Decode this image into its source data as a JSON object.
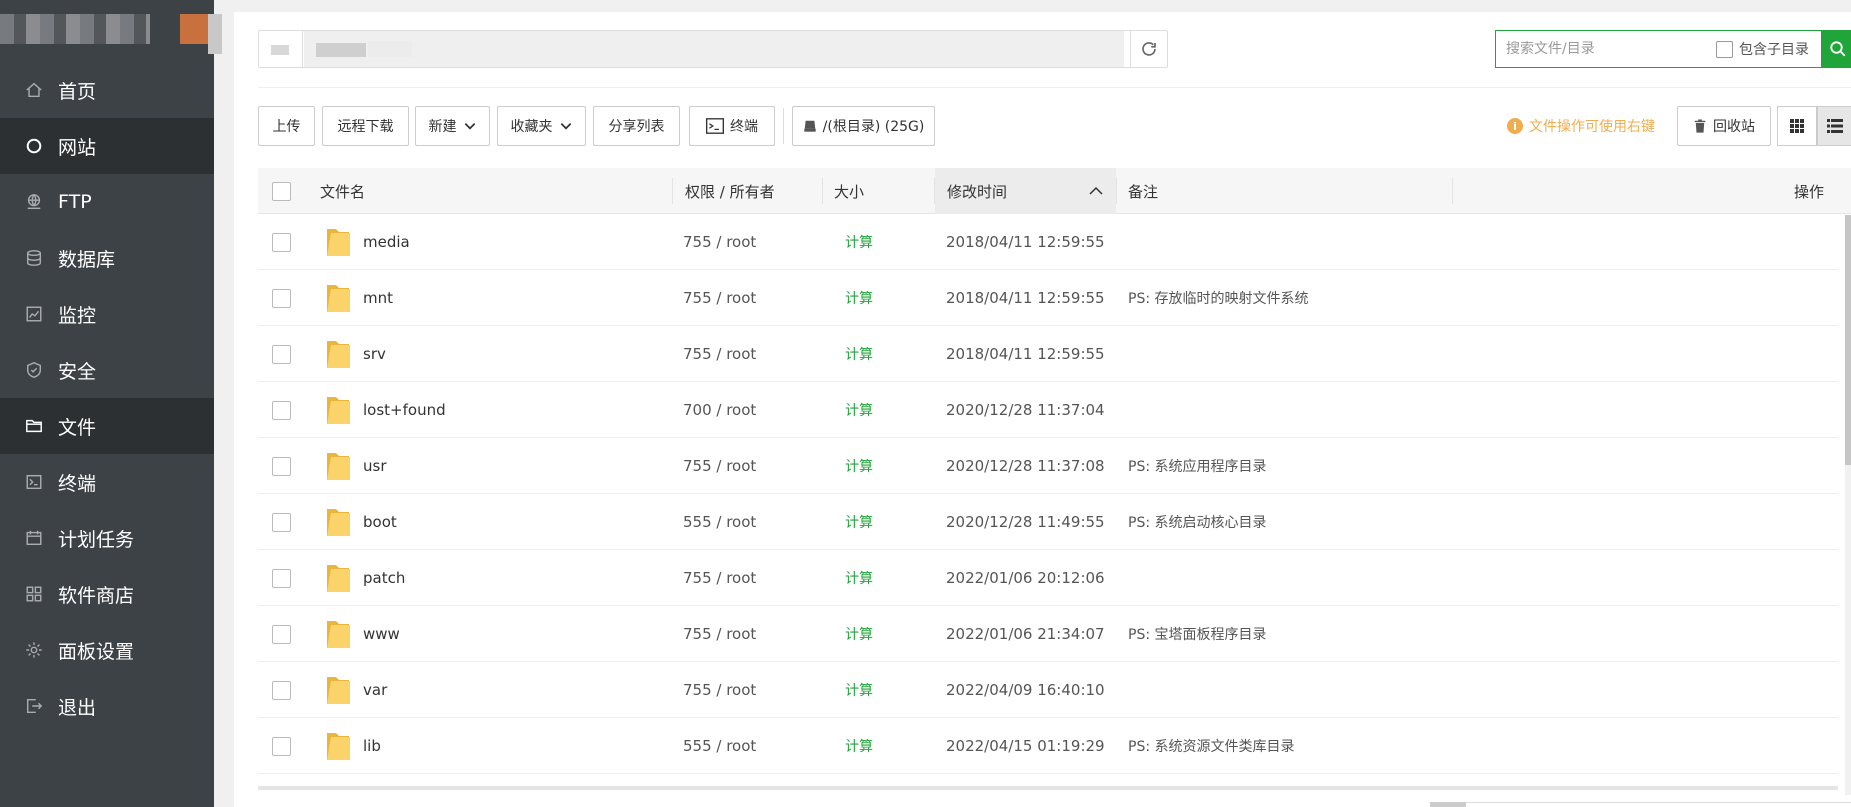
{
  "sidebar": {
    "items": [
      {
        "label": "首页",
        "icon": "home-icon"
      },
      {
        "label": "网站",
        "icon": "circle-icon",
        "active": true
      },
      {
        "label": "FTP",
        "icon": "ftp-icon"
      },
      {
        "label": "数据库",
        "icon": "database-icon"
      },
      {
        "label": "监控",
        "icon": "monitor-icon"
      },
      {
        "label": "安全",
        "icon": "shield-icon"
      },
      {
        "label": "文件",
        "icon": "folder-icon",
        "active": true
      },
      {
        "label": "终端",
        "icon": "terminal-icon"
      },
      {
        "label": "计划任务",
        "icon": "calendar-icon"
      },
      {
        "label": "软件商店",
        "icon": "apps-icon"
      },
      {
        "label": "面板设置",
        "icon": "gear-icon"
      },
      {
        "label": "退出",
        "icon": "logout-icon"
      }
    ]
  },
  "search": {
    "placeholder": "搜索文件/目录",
    "subdir_label": "包含子目录"
  },
  "toolbar": {
    "upload": "上传",
    "remote_download": "远程下载",
    "new": "新建",
    "favorites": "收藏夹",
    "share_list": "分享列表",
    "terminal": "终端",
    "disk": "/(根目录) (25G)",
    "tip": "文件操作可使用右键",
    "recycle": "回收站"
  },
  "table": {
    "headers": {
      "name": "文件名",
      "perm": "权限 / 所有者",
      "size": "大小",
      "mtime": "修改时间",
      "note": "备注",
      "ops": "操作"
    },
    "rows": [
      {
        "name": "media",
        "perm": "755 / root",
        "size": "计算",
        "mtime": "2018/04/11 12:59:55",
        "note": ""
      },
      {
        "name": "mnt",
        "perm": "755 / root",
        "size": "计算",
        "mtime": "2018/04/11 12:59:55",
        "note": "PS: 存放临时的映射文件系统"
      },
      {
        "name": "srv",
        "perm": "755 / root",
        "size": "计算",
        "mtime": "2018/04/11 12:59:55",
        "note": ""
      },
      {
        "name": "lost+found",
        "perm": "700 / root",
        "size": "计算",
        "mtime": "2020/12/28 11:37:04",
        "note": ""
      },
      {
        "name": "usr",
        "perm": "755 / root",
        "size": "计算",
        "mtime": "2020/12/28 11:37:08",
        "note": "PS: 系统应用程序目录"
      },
      {
        "name": "boot",
        "perm": "555 / root",
        "size": "计算",
        "mtime": "2020/12/28 11:49:55",
        "note": "PS: 系统启动核心目录"
      },
      {
        "name": "patch",
        "perm": "755 / root",
        "size": "计算",
        "mtime": "2022/01/06 20:12:06",
        "note": ""
      },
      {
        "name": "www",
        "perm": "755 / root",
        "size": "计算",
        "mtime": "2022/01/06 21:34:07",
        "note": "PS: 宝塔面板程序目录"
      },
      {
        "name": "var",
        "perm": "755 / root",
        "size": "计算",
        "mtime": "2022/04/09 16:40:10",
        "note": ""
      },
      {
        "name": "lib",
        "perm": "555 / root",
        "size": "计算",
        "mtime": "2022/04/15 01:19:29",
        "note": "PS: 系统资源文件类库目录"
      }
    ]
  },
  "colors": {
    "accent": "#20a53a",
    "sidebar_bg": "#3d4246",
    "sidebar_active": "#2d3033",
    "tip": "#f0ad4e",
    "folder": "#f7c948"
  }
}
